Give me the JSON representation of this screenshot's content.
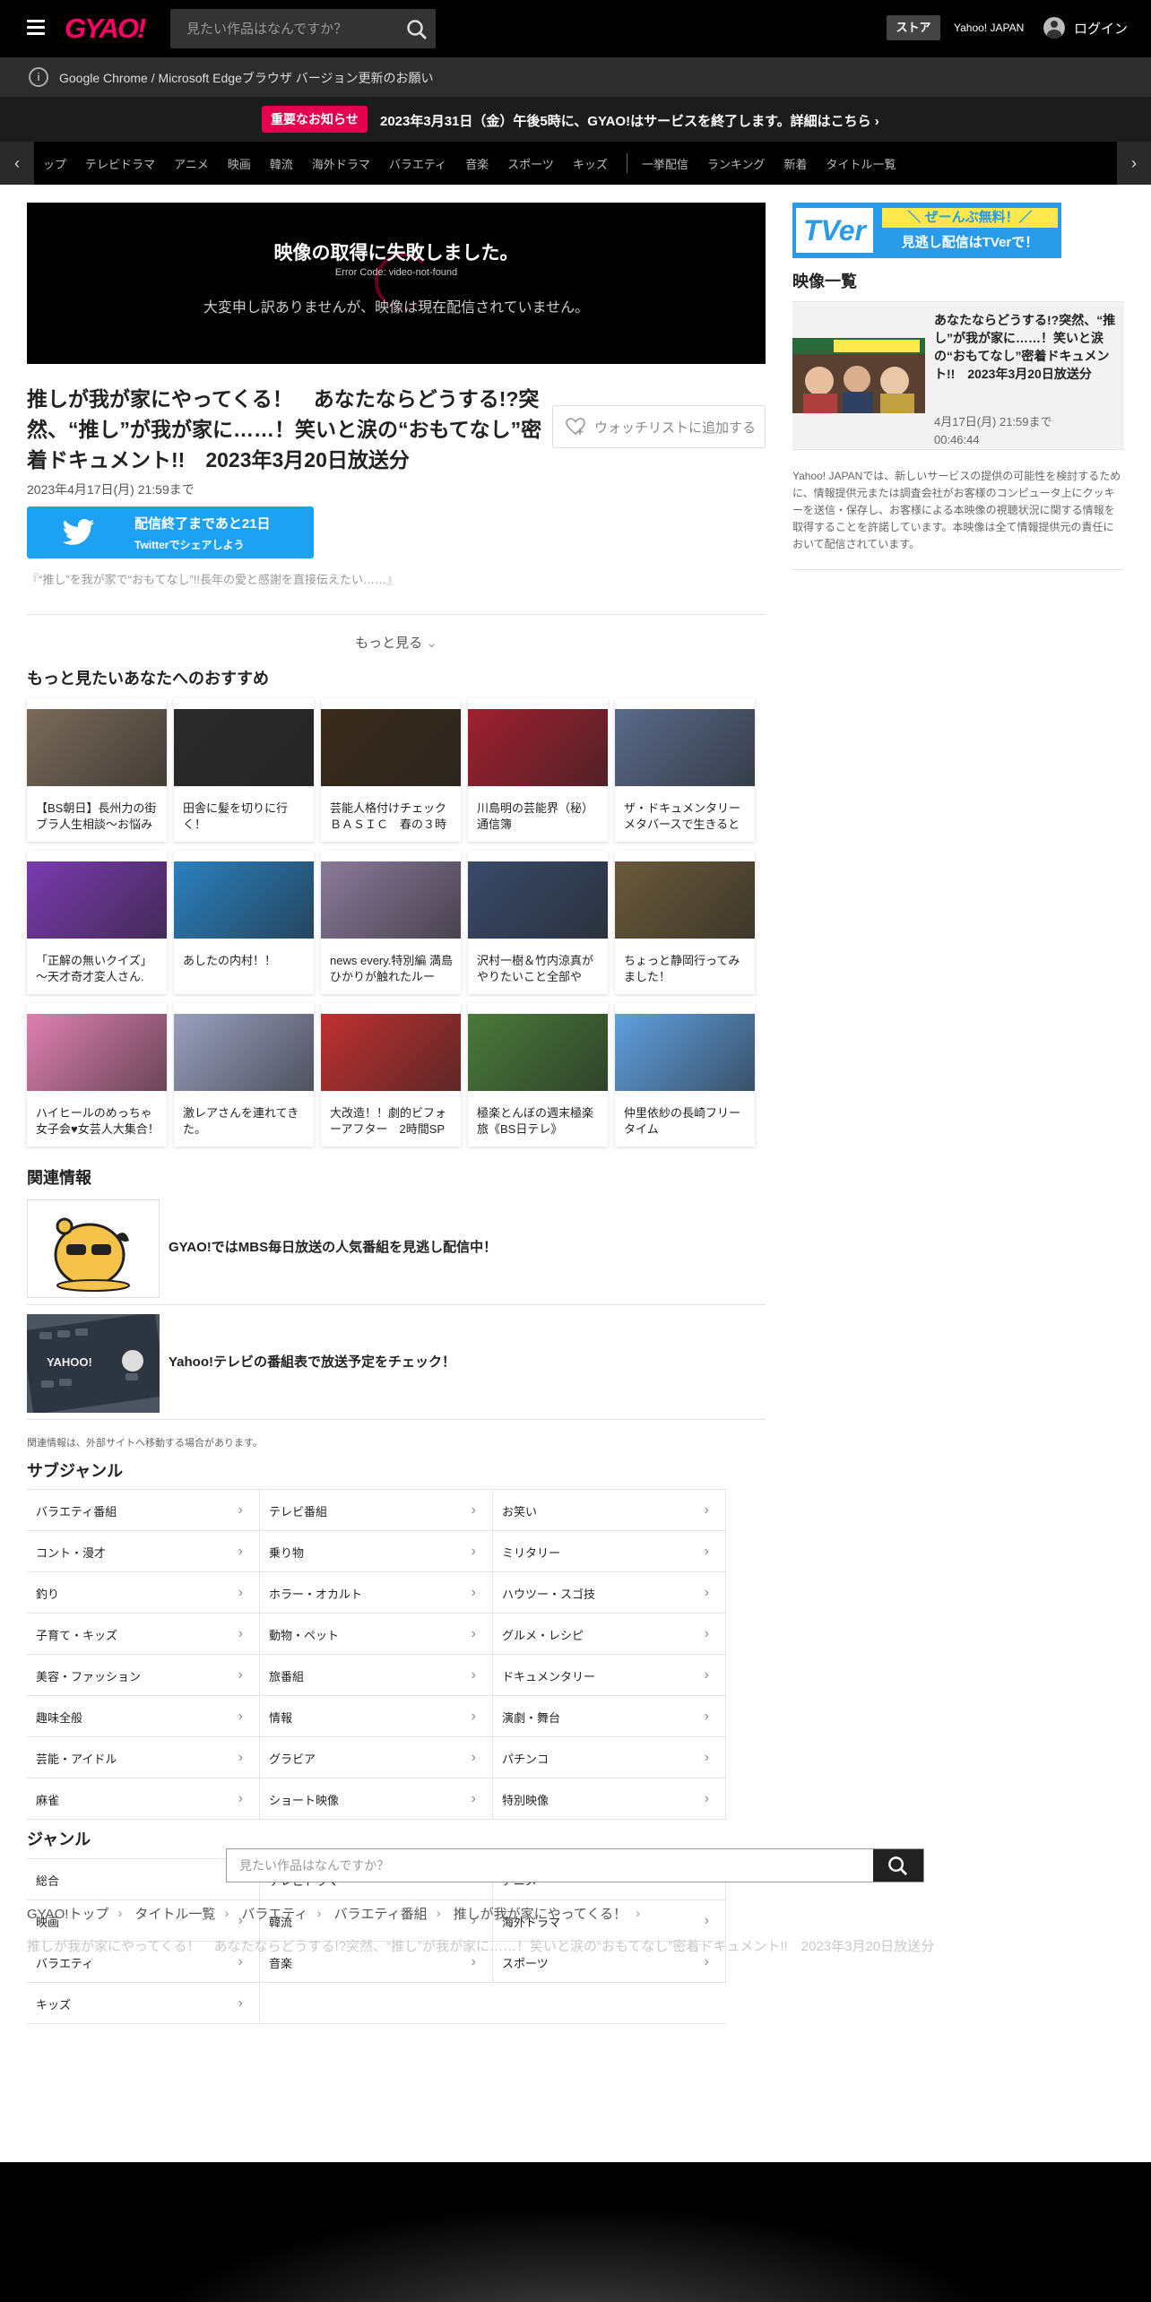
{
  "header": {
    "logo": "GYAO!",
    "search_placeholder": "見たい作品はなんですか？",
    "store": "ストア",
    "yahoo": "Yahoo! JAPAN",
    "login": "ログイン"
  },
  "notices": {
    "browser": "Google Chrome / Microsoft Edgeブラウザ バージョン更新のお願い",
    "badge": "重要なお知らせ",
    "important": "2023年3月31日（金）午後5時に、GYAO!はサービスを終了します。詳細はこちら"
  },
  "nav": {
    "items": [
      "ップ",
      "テレビドラマ",
      "アニメ",
      "映画",
      "韓流",
      "海外ドラマ",
      "バラエティ",
      "音楽",
      "スポーツ",
      "キッズ"
    ],
    "items2": [
      "一挙配信",
      "ランキング",
      "新着",
      "タイトル一覧"
    ]
  },
  "player": {
    "error": "映像の取得に失敗しました。",
    "code": "Error Code: video-not-found",
    "message": "大変申し訳ありませんが、映像は現在配信されていません。"
  },
  "program": {
    "title": "推しが我が家にやってくる！　あなたならどうする!?突然、“推し”が我が家に……！笑いと涙の“おもてなし”密着ドキュメント!!　2023年3月20日放送分",
    "watchlist": "ウォッチリストに追加する",
    "date": "2023年4月17日(月) 21:59まで",
    "twitter_l1": "配信終了まであと21日",
    "twitter_l2": "Twitterでシェアしよう",
    "desc": "『“推し”を我が家で“おもてなし”!!長年の愛と感謝を直接伝えたい……』",
    "more": "もっと見る"
  },
  "recommend": {
    "heading": "もっと見たいあなたへのおすすめ",
    "items": [
      {
        "title": "【BS朝日】長州力の街ブラ人生相談～お悩み",
        "color": "#7a6a5a"
      },
      {
        "title": "田舎に髪を切りに行く！",
        "color": "#2a2a2a"
      },
      {
        "title": "芸能人格付けチェック　ＢＡＳＩＣ　春の３時",
        "color": "#3a2a1a"
      },
      {
        "title": "川島明の芸能界（秘）通信簿",
        "color": "#a02030"
      },
      {
        "title": "ザ・ドキュメンタリー　メタバースで生きると",
        "color": "#5a6a8a"
      },
      {
        "title": "「正解の無いクイズ」～天才奇才変人さん.",
        "color": "#7a3ab0"
      },
      {
        "title": "あしたの内村！！",
        "color": "#2a80c0"
      },
      {
        "title": "news every.特別編 満島ひかりが触れたルー",
        "color": "#8a7a9a"
      },
      {
        "title": "沢村一樹＆竹内涼真がやりたいこと全部や",
        "color": "#3a4a6a"
      },
      {
        "title": "ちょっと静岡行ってみました！",
        "color": "#6a5a3a"
      },
      {
        "title": "ハイヒールのめっちゃ女子会♥女芸人大集合！",
        "color": "#e080b0"
      },
      {
        "title": "激レアさんを連れてきた。",
        "color": "#9aa0c0"
      },
      {
        "title": "大改造！！劇的ビフォーアフター　2時間SP",
        "color": "#c03030"
      },
      {
        "title": "極楽とんぼの週末極楽旅《BS日テレ》",
        "color": "#4a7a3a"
      },
      {
        "title": "仲里依紗の長崎フリータイム",
        "color": "#60a0e0"
      }
    ]
  },
  "related": {
    "heading": "関連情報",
    "items": [
      "GYAO!ではMBS毎日放送の人気番組を見逃し配信中！",
      "Yahoo!テレビの番組表で放送予定をチェック！"
    ],
    "note": "関連情報は、外部サイトへ移動する場合があります。"
  },
  "subgenre": {
    "heading": "サブジャンル",
    "items": [
      "バラエティ番組",
      "テレビ番組",
      "お笑い",
      "コント・漫才",
      "乗り物",
      "ミリタリー",
      "釣り",
      "ホラー・オカルト",
      "ハウツー・スゴ技",
      "子育て・キッズ",
      "動物・ペット",
      "グルメ・レシピ",
      "美容・ファッション",
      "旅番組",
      "ドキュメンタリー",
      "趣味全般",
      "情報",
      "演劇・舞台",
      "芸能・アイドル",
      "グラビア",
      "パチンコ",
      "麻雀",
      "ショート映像",
      "特別映像"
    ]
  },
  "genre": {
    "heading": "ジャンル",
    "items": [
      "総合",
      "テレビドラマ",
      "アニメ",
      "映画",
      "韓流",
      "海外ドラマ",
      "バラエティ",
      "音楽",
      "スポーツ",
      "キッズ"
    ]
  },
  "bottom_search": {
    "placeholder": "見たい作品はなんですか？"
  },
  "breadcrumb": {
    "items": [
      "GYAO!トップ",
      "タイトル一覧",
      "バラエティ",
      "バラエティ番組",
      "推しが我が家にやってくる！"
    ],
    "current": "推しが我が家にやってくる！　あなたならどうする!?突然、“推し”が我が家に……！笑いと涙の“おもてなし”密着ドキュメント!!　2023年3月20日放送分"
  },
  "sidebar": {
    "tver_logo": "TVer",
    "tver_yellow": "＼ ぜーんぶ無料！／",
    "tver_white": "見逃し配信はTVerで！",
    "list_label": "映像一覧",
    "video_title": "あなたならどうする!?突然、“推し”が我が家に……！笑いと涙の“おもてなし”密着ドキュメント!!　2023年3月20日放送分",
    "video_date": "4月17日(月) 21:59まで",
    "video_duration": "00:46:44",
    "note": "Yahoo! JAPANでは、新しいサービスの提供の可能性を検討するために、情報提供元または調査会社がお客様のコンピュータ上にクッキーを送信・保存し、お客様による本映像の視聴状況に関する情報を取得することを許諾しています。本映像は全て情報提供元の責任において配信されています。"
  },
  "icons": {
    "menu": "menu-icon",
    "search": "search-icon",
    "info": "info-icon",
    "heart": "heart-icon",
    "twitter": "twitter-bird-icon",
    "chevron": "chevron-right-icon"
  },
  "colors": {
    "brand": "#ff0066",
    "badge": "#e5004f",
    "twitter": "#1da1f2",
    "tver": "#2a9be8"
  }
}
